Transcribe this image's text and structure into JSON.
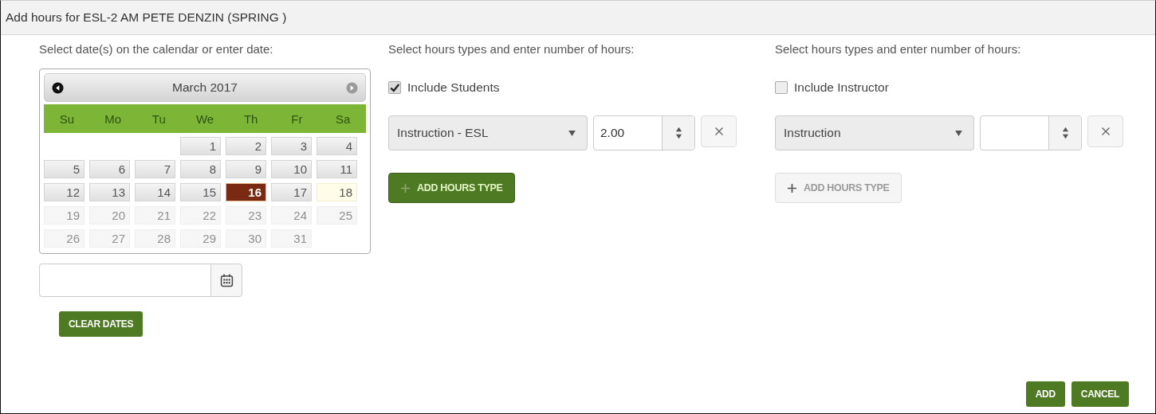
{
  "window": {
    "title": "Add hours for ESL-2 AM PETE DENZIN (SPRING )"
  },
  "dates": {
    "instruction": "Select date(s) on the calendar or enter date:",
    "calendar": {
      "month": "March 2017",
      "prev_disabled": false,
      "next_disabled": true,
      "weekdays": [
        "Su",
        "Mo",
        "Tu",
        "We",
        "Th",
        "Fr",
        "Sa"
      ],
      "weeks": [
        [
          {
            "day": "1",
            "kind": "open",
            "selected": false
          },
          {
            "day": "2",
            "kind": "open",
            "selected": false
          },
          {
            "day": "3",
            "kind": "open",
            "selected": false
          },
          {
            "day": "4",
            "kind": "open",
            "selected": false
          }
        ],
        [
          {
            "day": "5",
            "kind": "open",
            "selected": false
          },
          {
            "day": "6",
            "kind": "open",
            "selected": false
          },
          {
            "day": "7",
            "kind": "open",
            "selected": false
          },
          {
            "day": "8",
            "kind": "open",
            "selected": false
          },
          {
            "day": "9",
            "kind": "open",
            "selected": false
          },
          {
            "day": "10",
            "kind": "open",
            "selected": false
          },
          {
            "day": "11",
            "kind": "open",
            "selected": false
          }
        ],
        [
          {
            "day": "12",
            "kind": "open",
            "selected": false
          },
          {
            "day": "13",
            "kind": "open",
            "selected": false
          },
          {
            "day": "14",
            "kind": "open",
            "selected": false
          },
          {
            "day": "15",
            "kind": "open",
            "selected": false
          },
          {
            "day": "16",
            "kind": "open",
            "selected": true
          },
          {
            "day": "17",
            "kind": "open",
            "selected": false
          },
          {
            "day": "18",
            "kind": "today",
            "selected": false
          }
        ],
        [
          {
            "day": "19",
            "kind": "disabled",
            "selected": false
          },
          {
            "day": "20",
            "kind": "disabled",
            "selected": false
          },
          {
            "day": "21",
            "kind": "disabled",
            "selected": false
          },
          {
            "day": "22",
            "kind": "disabled",
            "selected": false
          },
          {
            "day": "23",
            "kind": "disabled",
            "selected": false
          },
          {
            "day": "24",
            "kind": "disabled",
            "selected": false
          },
          {
            "day": "25",
            "kind": "disabled",
            "selected": false
          }
        ],
        [
          {
            "day": "26",
            "kind": "disabled",
            "selected": false
          },
          {
            "day": "27",
            "kind": "disabled",
            "selected": false
          },
          {
            "day": "28",
            "kind": "disabled",
            "selected": false
          },
          {
            "day": "29",
            "kind": "disabled",
            "selected": false
          },
          {
            "day": "30",
            "kind": "disabled",
            "selected": false
          },
          {
            "day": "31",
            "kind": "disabled",
            "selected": false
          }
        ]
      ]
    },
    "clear_button": "CLEAR DATES"
  },
  "hour_groups": [
    {
      "instruction": "Select hours types and enter number of hours:",
      "include_label": "Include Students",
      "checked": true,
      "rows": [
        {
          "type": "Instruction - ESL",
          "hours": "2.00"
        }
      ],
      "add_button": "ADD HOURS TYPE",
      "add_disabled": false
    },
    {
      "instruction": "Select hours types and enter number of hours:",
      "include_label": "Include Instructor",
      "checked": false,
      "rows": [
        {
          "type": "Instruction"
        }
      ],
      "add_button": "ADD HOURS TYPE",
      "add_disabled": true
    }
  ],
  "buttons": [
    "ADD",
    "CANCEL"
  ]
}
